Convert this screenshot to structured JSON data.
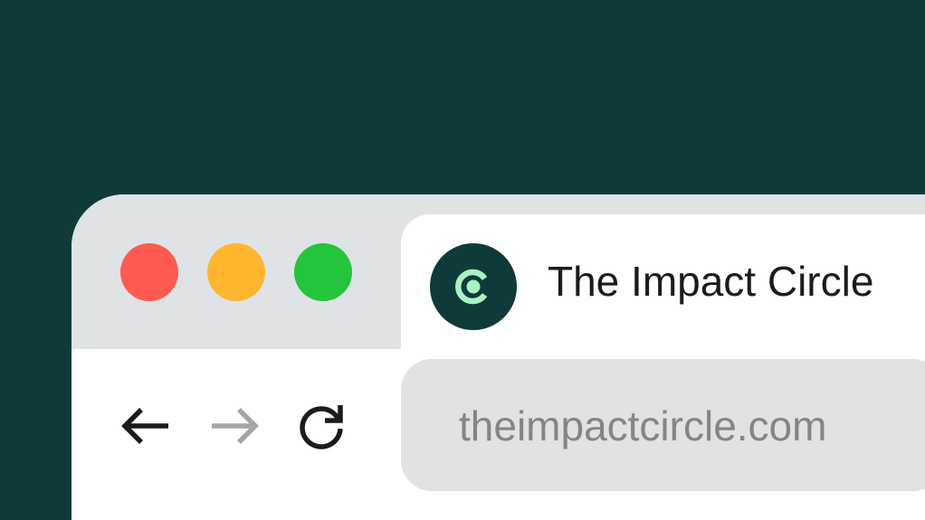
{
  "window": {
    "controls": {
      "close_color": "#ff5a52",
      "minimize_color": "#ffb52e",
      "maximize_color": "#22c53b"
    }
  },
  "tab": {
    "title": "The Impact Circle",
    "favicon": {
      "icon": "c-logo-icon",
      "background_color": "#0f3a3a",
      "accent_color": "#a8f3c1"
    }
  },
  "toolbar": {
    "back_icon": "arrow-left-icon",
    "forward_icon": "arrow-right-icon",
    "reload_icon": "reload-icon"
  },
  "address_bar": {
    "url": "theimpactcircle.com"
  },
  "colors": {
    "background": "#0f3a3a",
    "chrome": "#dfe3e5",
    "surface": "#ffffff",
    "text": "#1b1b1b",
    "muted_text": "#80868a"
  }
}
